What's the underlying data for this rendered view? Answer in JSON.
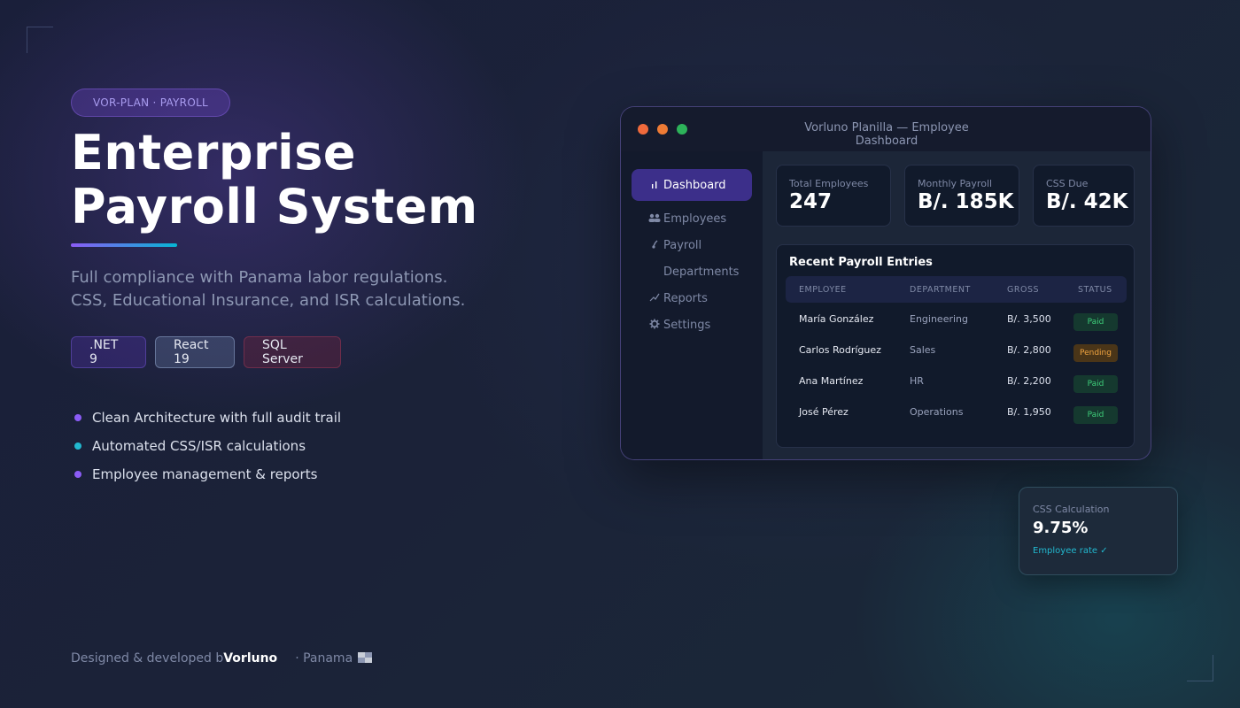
{
  "hero": {
    "badge": "VOR-PLAN · PAYROLL",
    "title_line1": "Enterprise",
    "title_line2": "Payroll System",
    "subtitle_line1": "Full compliance with Panama labor regulations.",
    "subtitle_line2": "CSS, Educational Insurance, and ISR calculations.",
    "techs": [
      ".NET 9",
      "React 19",
      "SQL Server"
    ],
    "features": [
      {
        "text": "Clean Architecture with full audit trail",
        "color": "#8b5cf6"
      },
      {
        "text": "Automated CSS/ISR calculations",
        "color": "#22b8cf"
      },
      {
        "text": "Employee management & reports",
        "color": "#8b5cf6"
      }
    ]
  },
  "footer": {
    "prefix": "Designed & developed b",
    "brand": "Vorluno",
    "location": "· Panama",
    "flag_icon": "panama-flag-icon"
  },
  "window": {
    "title": "Vorluno Planilla — Employee Dashboard",
    "sidebar": [
      {
        "label": "Dashboard",
        "icon": "chart-icon",
        "glyph": "╷ı",
        "active": true
      },
      {
        "label": "Employees",
        "icon": "users-icon",
        "glyph": "👥",
        "active": false
      },
      {
        "label": "Payroll",
        "icon": "money-icon",
        "glyph": "💰",
        "active": false
      },
      {
        "label": "Departments",
        "icon": "building-icon",
        "glyph": "",
        "active": false
      },
      {
        "label": "Reports",
        "icon": "trend-icon",
        "glyph": "📈",
        "active": false
      },
      {
        "label": "Settings",
        "icon": "gear-icon",
        "glyph": "⚙",
        "active": false
      }
    ],
    "stats": [
      {
        "label": "Total Employees",
        "value": "247"
      },
      {
        "label": "Monthly Payroll",
        "value": "B/. 185K"
      },
      {
        "label": "CSS Due",
        "value": "B/. 42K"
      }
    ],
    "recent": {
      "title": "Recent Payroll Entries",
      "columns": [
        "EMPLOYEE",
        "DEPARTMENT",
        "GROSS",
        "STATUS"
      ],
      "rows": [
        {
          "employee": "María González",
          "department": "Engineering",
          "gross": "B/. 3,500",
          "status": "Paid"
        },
        {
          "employee": "Carlos Rodríguez",
          "department": "Sales",
          "gross": "B/. 2,800",
          "status": "Pending"
        },
        {
          "employee": "Ana Martínez",
          "department": "HR",
          "gross": "B/. 2,200",
          "status": "Paid"
        },
        {
          "employee": "José Pérez",
          "department": "Operations",
          "gross": "B/. 1,950",
          "status": "Paid"
        }
      ]
    }
  },
  "float_card": {
    "label": "CSS Calculation",
    "value": "9.75%",
    "note": "Employee rate ✓"
  }
}
